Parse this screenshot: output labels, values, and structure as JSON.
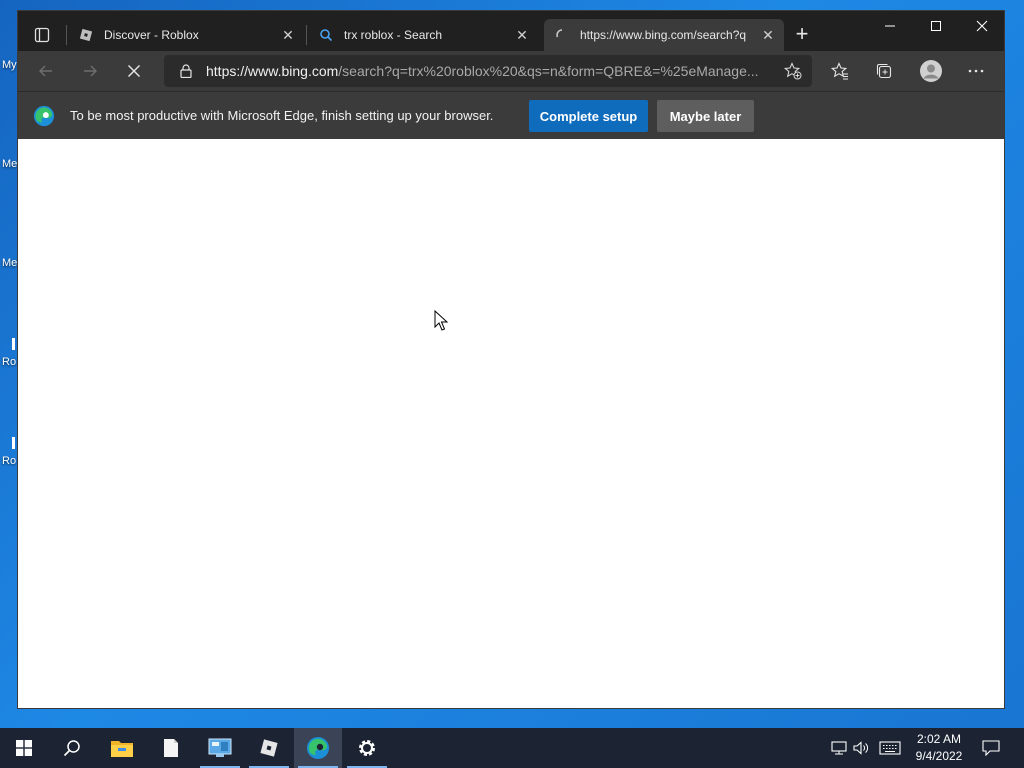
{
  "desktop": {
    "labels": [
      "My",
      "Me",
      "Me",
      "Ro",
      "Ro"
    ]
  },
  "tabs": [
    {
      "title": "Discover - Roblox",
      "icon": "roblox-icon"
    },
    {
      "title": "trx roblox - Search",
      "icon": "search-icon"
    },
    {
      "title": "https://www.bing.com/search?q",
      "icon": "loading-spinner-icon",
      "active": true
    }
  ],
  "address_bar": {
    "host": "https://www.bing.com",
    "path": "/search?q=trx%20roblox%20&qs=n&form=QBRE&=%25eManage..."
  },
  "infobar": {
    "message": "To be most productive with Microsoft Edge, finish setting up your browser.",
    "primary_label": "Complete setup",
    "secondary_label": "Maybe later"
  },
  "taskbar": {
    "apps": [
      "start-icon",
      "search-icon",
      "file-explorer-icon",
      "document-icon",
      "control-panel-icon",
      "roblox-icon",
      "edge-icon",
      "settings-icon"
    ],
    "time": "2:02 AM",
    "date": "9/4/2022"
  },
  "colors": {
    "accent": "#0f6cbd",
    "toolbar": "#3b3b3b",
    "tabstrip": "#202020",
    "taskbar": "#1c2433"
  }
}
